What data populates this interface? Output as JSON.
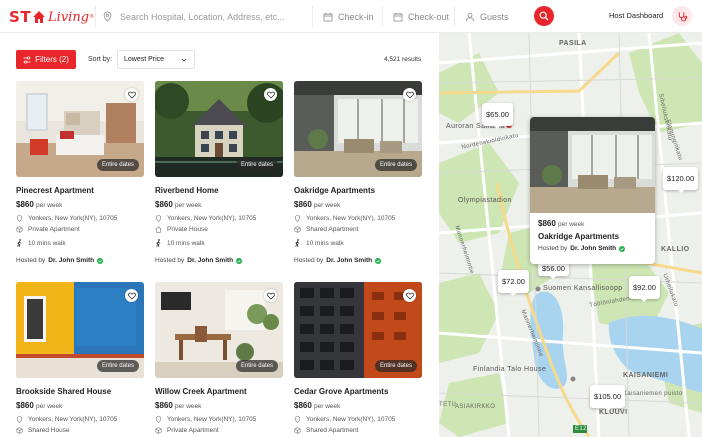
{
  "header": {
    "logo_text": "STAYLiving",
    "search_placeholder": "Search Hospital, Location, Address, etc...",
    "checkin_label": "Check-in",
    "checkout_label": "Check-out",
    "guests_label": "Guests",
    "host_dashboard_label": "Host Dashboard"
  },
  "toolbar": {
    "filters_label": "Filters (2)",
    "sort_label": "Sort by:",
    "sort_value": "Lowest Price",
    "results_label": "4,521 results"
  },
  "listings": [
    {
      "name": "Pinecrest Apartment",
      "price": "$860",
      "per": "per week",
      "location": "Yonkers, New York(NY), 10705",
      "type": "Private Apartment",
      "walk": "10 mins walk",
      "hosted_prefix": "Hosted by",
      "host": "Dr. John Smith",
      "badge": "Entire dates"
    },
    {
      "name": "Riverbend Home",
      "price": "$860",
      "per": "per week",
      "location": "Yonkers, New York(NY), 10705",
      "type": "Private House",
      "walk": "10 mins walk",
      "hosted_prefix": "Hosted by",
      "host": "Dr. John Smith",
      "badge": "Entire dates"
    },
    {
      "name": "Oakridge Apartments",
      "price": "$860",
      "per": "per week",
      "location": "Yonkers, New York(NY), 10705",
      "type": "Shared Apartment",
      "walk": "10 mins walk",
      "hosted_prefix": "Hosted by",
      "host": "Dr. John Smith",
      "badge": "Entire dates"
    },
    {
      "name": "Brookside Shared House",
      "price": "$860",
      "per": "per week",
      "location": "Yonkers, New York(NY), 10705",
      "type": "Shared House",
      "badge": "Entire dates"
    },
    {
      "name": "Willow Creek Apartment",
      "price": "$860",
      "per": "per week",
      "location": "Yonkers, New York(NY), 10705",
      "type": "Private Apartment",
      "badge": "Entire dates"
    },
    {
      "name": "Cedar Grove Apartments",
      "price": "$860",
      "per": "per week",
      "location": "Yonkers, New York(NY), 10705",
      "type": "Shared Apartment",
      "badge": "Entire dates"
    }
  ],
  "map": {
    "price_pins": [
      "$65.00",
      "$120.00",
      "$56.00",
      "$72.00",
      "$92.00",
      "$105.00"
    ],
    "labels": {
      "pasila": "PASILA",
      "auroran": "Auroran Sairaala",
      "olympia": "Olympiastadion",
      "kallio": "KALLIO",
      "suomen": "Suomen Kansallisoopp",
      "finlandia": "Finlandia Talo House",
      "kaisaniemi": "KAISANIEMI",
      "kaisaniemi_puisto": "Kaisaniemen puisto",
      "kluuvi": "KLUUVI",
      "mannerheimintie": "Mannerheimintie",
      "mannerheimintie2": "Mannerheimintie",
      "sibeliuksenkatu": "Sibeliuksenkatu",
      "nordenskioldinkatu": "Nordenskiöldinkatu",
      "tetu": "TETU",
      "asiakirkko": "ASIAKIRKKO",
      "urheilukatu": "Urheilukatu",
      "fleminginkatu": "Fleminginkatu",
      "toolonlahdenkatu": "Töölönlahdenkatu",
      "e12": "E12"
    },
    "popup": {
      "price": "$860",
      "per": "per week",
      "name": "Oakridge Apartments",
      "hosted_prefix": "Hosted by",
      "host": "Dr. John Smith"
    }
  },
  "colors": {
    "brand_red": "#e8262b",
    "verified_green": "#22b14c",
    "map_water": "#a8d4f0",
    "map_park": "#cde6b4"
  }
}
